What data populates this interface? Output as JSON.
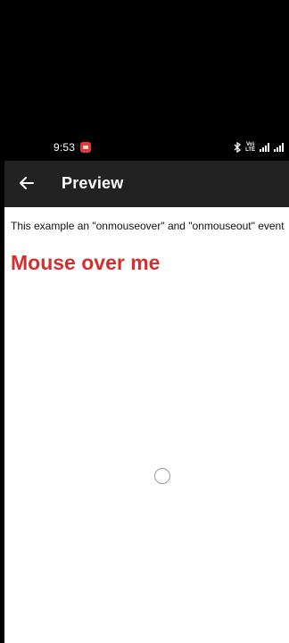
{
  "status_bar": {
    "time": "9:53",
    "volte_line1": "Vo)",
    "volte_line2": "LTE"
  },
  "appbar": {
    "title": "Preview"
  },
  "content": {
    "description": "This example an \"onmouseover\" and \"onmouseout\" event",
    "heading": "Mouse over me",
    "heading_color": "#d32f2f"
  }
}
